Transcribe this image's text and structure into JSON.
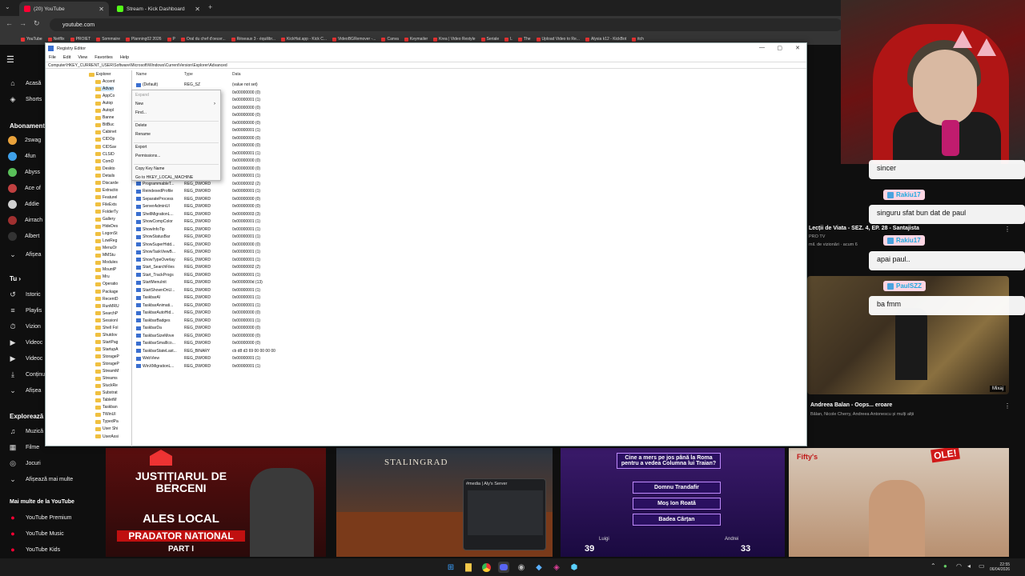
{
  "browser": {
    "tabs": [
      {
        "label": "(20) YouTube",
        "active": true
      },
      {
        "label": "Stream - Kick Dashboard",
        "active": false
      }
    ],
    "url": "youtube.com",
    "bookmarks": [
      "YouTube",
      "Netflix",
      "PROIET",
      "Sommaire",
      "Planning02 2026",
      "P",
      "Oral du chef d'oeuvr...",
      "Réseaux 3 - équilibr...",
      "KickHat.app - Kick C...",
      "VideoBGRemover -...",
      "Canva",
      "Keymailer",
      "Krea | Video Restyle",
      "Seriale",
      "L",
      "The",
      "Upload Video to Re...",
      "Alysia k12 - KickBot",
      "itch"
    ]
  },
  "sidebar": {
    "home": "Acasă",
    "shorts": "Shorts",
    "subs_header": "Abonamente",
    "subs": [
      "2swag",
      "4fun",
      "Abyss",
      "Ace of",
      "Addie",
      "Airrach",
      "Albert"
    ],
    "show_more_subs": "Afișea",
    "you_header": "Tu",
    "you_items": [
      "Istoric",
      "Playlis",
      "Vizion",
      "Videoc",
      "Videoc",
      "Conținu",
      "Afișea"
    ],
    "explore_header": "Explorează",
    "explore_items": [
      "Muzică",
      "Filme",
      "Jocuri",
      "Afișează mai multe"
    ],
    "more_header": "Mai multe de la YouTube",
    "more_items": [
      "YouTube Premium",
      "YouTube Music",
      "YouTube Kids"
    ]
  },
  "regedit": {
    "title": "Registry Editor",
    "menu": [
      "File",
      "Edit",
      "View",
      "Favorites",
      "Help"
    ],
    "address": "Computer\\HKEY_CURRENT_USER\\Software\\Microsoft\\Windows\\CurrentVersion\\Explorer\\Advanced",
    "tree": [
      "Explorer",
      "Accent",
      "Advan",
      "AppCo",
      "Autop",
      "Autopl",
      "Banne",
      "BitBuc",
      "Cabinet",
      "CIDOp",
      "CIDSav",
      "CLSID",
      "ComD",
      "Deskto",
      "Details",
      "Discarde",
      "Extractio",
      "Featurel",
      "FileExts",
      "FolderTy",
      "Gallery",
      "HideDes",
      "LogonSt",
      "LowReg",
      "MenuOr",
      "MMStu",
      "Modules",
      "MountP",
      "Mru",
      "Operatio",
      "Package",
      "RecentD",
      "RunMRU",
      "SearchP",
      "Sessionl",
      "Shell Fol",
      "Shutdov",
      "StartPag",
      "StartupA",
      "StorageP",
      "StorageP",
      "StreamM",
      "Streams",
      "StuckRe",
      "Substrat",
      "TabletM",
      "Taskban",
      "TWinUI",
      "TypedPa",
      "User Shi",
      "UserAssi"
    ],
    "col_name": "Name",
    "col_type": "Type",
    "col_data": "Data",
    "rows": [
      {
        "n": "(Default)",
        "t": "REG_SZ",
        "d": "(value not set)"
      },
      {
        "n": "",
        "t": "",
        "d": "0x00000000 (0)"
      },
      {
        "n": "",
        "t": "",
        "d": "0x00000001 (1)"
      },
      {
        "n": "",
        "t": "",
        "d": "0x00000000 (0)"
      },
      {
        "n": "",
        "t": "",
        "d": "0x00000000 (0)"
      },
      {
        "n": "",
        "t": "",
        "d": "0x00000000 (0)"
      },
      {
        "n": "",
        "t": "",
        "d": "0x00000001 (1)"
      },
      {
        "n": "",
        "t": "",
        "d": "0x00000000 (0)"
      },
      {
        "n": "",
        "t": "",
        "d": "0x00000000 (0)"
      },
      {
        "n": "",
        "t": "",
        "d": "0x00000001 (1)"
      },
      {
        "n": "",
        "t": "",
        "d": "0x00000000 (0)"
      },
      {
        "n": "",
        "t": "",
        "d": "0x00000000 (0)"
      },
      {
        "n": "",
        "t": "",
        "d": "0x00000001 (1)"
      },
      {
        "n": "ProgrammableT...",
        "t": "REG_DWORD",
        "d": "0x00000002 (2)"
      },
      {
        "n": "ReindexedProfile",
        "t": "REG_DWORD",
        "d": "0x00000001 (1)"
      },
      {
        "n": "SeparateProcess",
        "t": "REG_DWORD",
        "d": "0x00000000 (0)"
      },
      {
        "n": "ServerAdminUI",
        "t": "REG_DWORD",
        "d": "0x00000000 (0)"
      },
      {
        "n": "ShellMigrationL...",
        "t": "REG_DWORD",
        "d": "0x00000003 (3)"
      },
      {
        "n": "ShowCompColor",
        "t": "REG_DWORD",
        "d": "0x00000001 (1)"
      },
      {
        "n": "ShowInfoTip",
        "t": "REG_DWORD",
        "d": "0x00000001 (1)"
      },
      {
        "n": "ShowStatusBar",
        "t": "REG_DWORD",
        "d": "0x00000001 (1)"
      },
      {
        "n": "ShowSuperHidd...",
        "t": "REG_DWORD",
        "d": "0x00000000 (0)"
      },
      {
        "n": "ShowTaskViewB...",
        "t": "REG_DWORD",
        "d": "0x00000001 (1)"
      },
      {
        "n": "ShowTypeOverlay",
        "t": "REG_DWORD",
        "d": "0x00000001 (1)"
      },
      {
        "n": "Start_SearchFiles",
        "t": "REG_DWORD",
        "d": "0x00000002 (2)"
      },
      {
        "n": "Start_TrackProgs",
        "t": "REG_DWORD",
        "d": "0x00000001 (1)"
      },
      {
        "n": "StartMenuInit",
        "t": "REG_DWORD",
        "d": "0x0000000d (13)"
      },
      {
        "n": "StartShownOnU...",
        "t": "REG_DWORD",
        "d": "0x00000001 (1)"
      },
      {
        "n": "TaskbarAl",
        "t": "REG_DWORD",
        "d": "0x00000001 (1)"
      },
      {
        "n": "TaskbarAnimati...",
        "t": "REG_DWORD",
        "d": "0x00000001 (1)"
      },
      {
        "n": "TaskbarAutoHid...",
        "t": "REG_DWORD",
        "d": "0x00000000 (0)"
      },
      {
        "n": "TaskbarBadges",
        "t": "REG_DWORD",
        "d": "0x00000001 (1)"
      },
      {
        "n": "TaskbarDa",
        "t": "REG_DWORD",
        "d": "0x00000000 (0)"
      },
      {
        "n": "TaskbarSizeMove",
        "t": "REG_DWORD",
        "d": "0x00000000 (0)"
      },
      {
        "n": "TaskbarSmallIco...",
        "t": "REG_DWORD",
        "d": "0x00000000 (0)"
      },
      {
        "n": "TaskbarStateLast...",
        "t": "REG_BINARY",
        "d": "cb d8 d3 69 00 00 00 00"
      },
      {
        "n": "WebView",
        "t": "REG_DWORD",
        "d": "0x00000001 (1)"
      },
      {
        "n": "WinXMigrationL...",
        "t": "REG_DWORD",
        "d": "0x00000001 (1)"
      }
    ],
    "context_menu": [
      {
        "label": "Expand",
        "disabled": true
      },
      {
        "label": "New",
        "submenu": true
      },
      {
        "label": "Find..."
      },
      {
        "sep": true
      },
      {
        "label": "Delete"
      },
      {
        "label": "Rename"
      },
      {
        "sep": true
      },
      {
        "label": "Export"
      },
      {
        "label": "Permissions..."
      },
      {
        "sep": true
      },
      {
        "label": "Copy Key Name"
      },
      {
        "label": "Go to HKEY_LOCAL_MACHINE"
      }
    ]
  },
  "chat": [
    {
      "user": "",
      "text": "sincer"
    },
    {
      "user": "Rakiu17",
      "text": "singuru sfat bun dat de paul"
    },
    {
      "user": "Rakiu17",
      "text": "apai paul.."
    },
    {
      "user": "PaulSZZ",
      "text": "ba fmm"
    }
  ],
  "recs": {
    "item1_title": "Lecții de Viata - SEZ. 4, EP. 28 - Santajista",
    "item1_channel": "PRO TV",
    "item1_meta": "mil. de vizionări · acum 6",
    "item2_title": "Andreea Balan - Oops... eroare",
    "item2_meta": "Bălan, Nicole Cherry, Andreea Antonescu și mulți alții",
    "item2_duration": "Mixaj"
  },
  "grid": {
    "v1_top": "JUSTIȚIARUL DE BERCENI",
    "v1_mid": "ALES LOCAL",
    "v1_bottom": "PRADATOR NATIONAL",
    "v1_part": "PART I",
    "v2_title": "STALINGRAD",
    "v3_question": "Cine a mers pe jos până la Roma pentru a vedea Columna lui Traian?",
    "v3_options": [
      "Domnu Trandafir",
      "Moș Ion Roată",
      "Badea Cârțan"
    ],
    "v3_score_left": "39",
    "v3_score_right": "33",
    "v3_name_left": "Luigi",
    "v3_name_right": "Andrei",
    "v4_badge": "OLE!",
    "v4_brand": "Fifty's"
  },
  "discord": {
    "title": "#media | Aly's Server"
  },
  "tray": {
    "time": "22:55",
    "date": "06/04/2026"
  }
}
